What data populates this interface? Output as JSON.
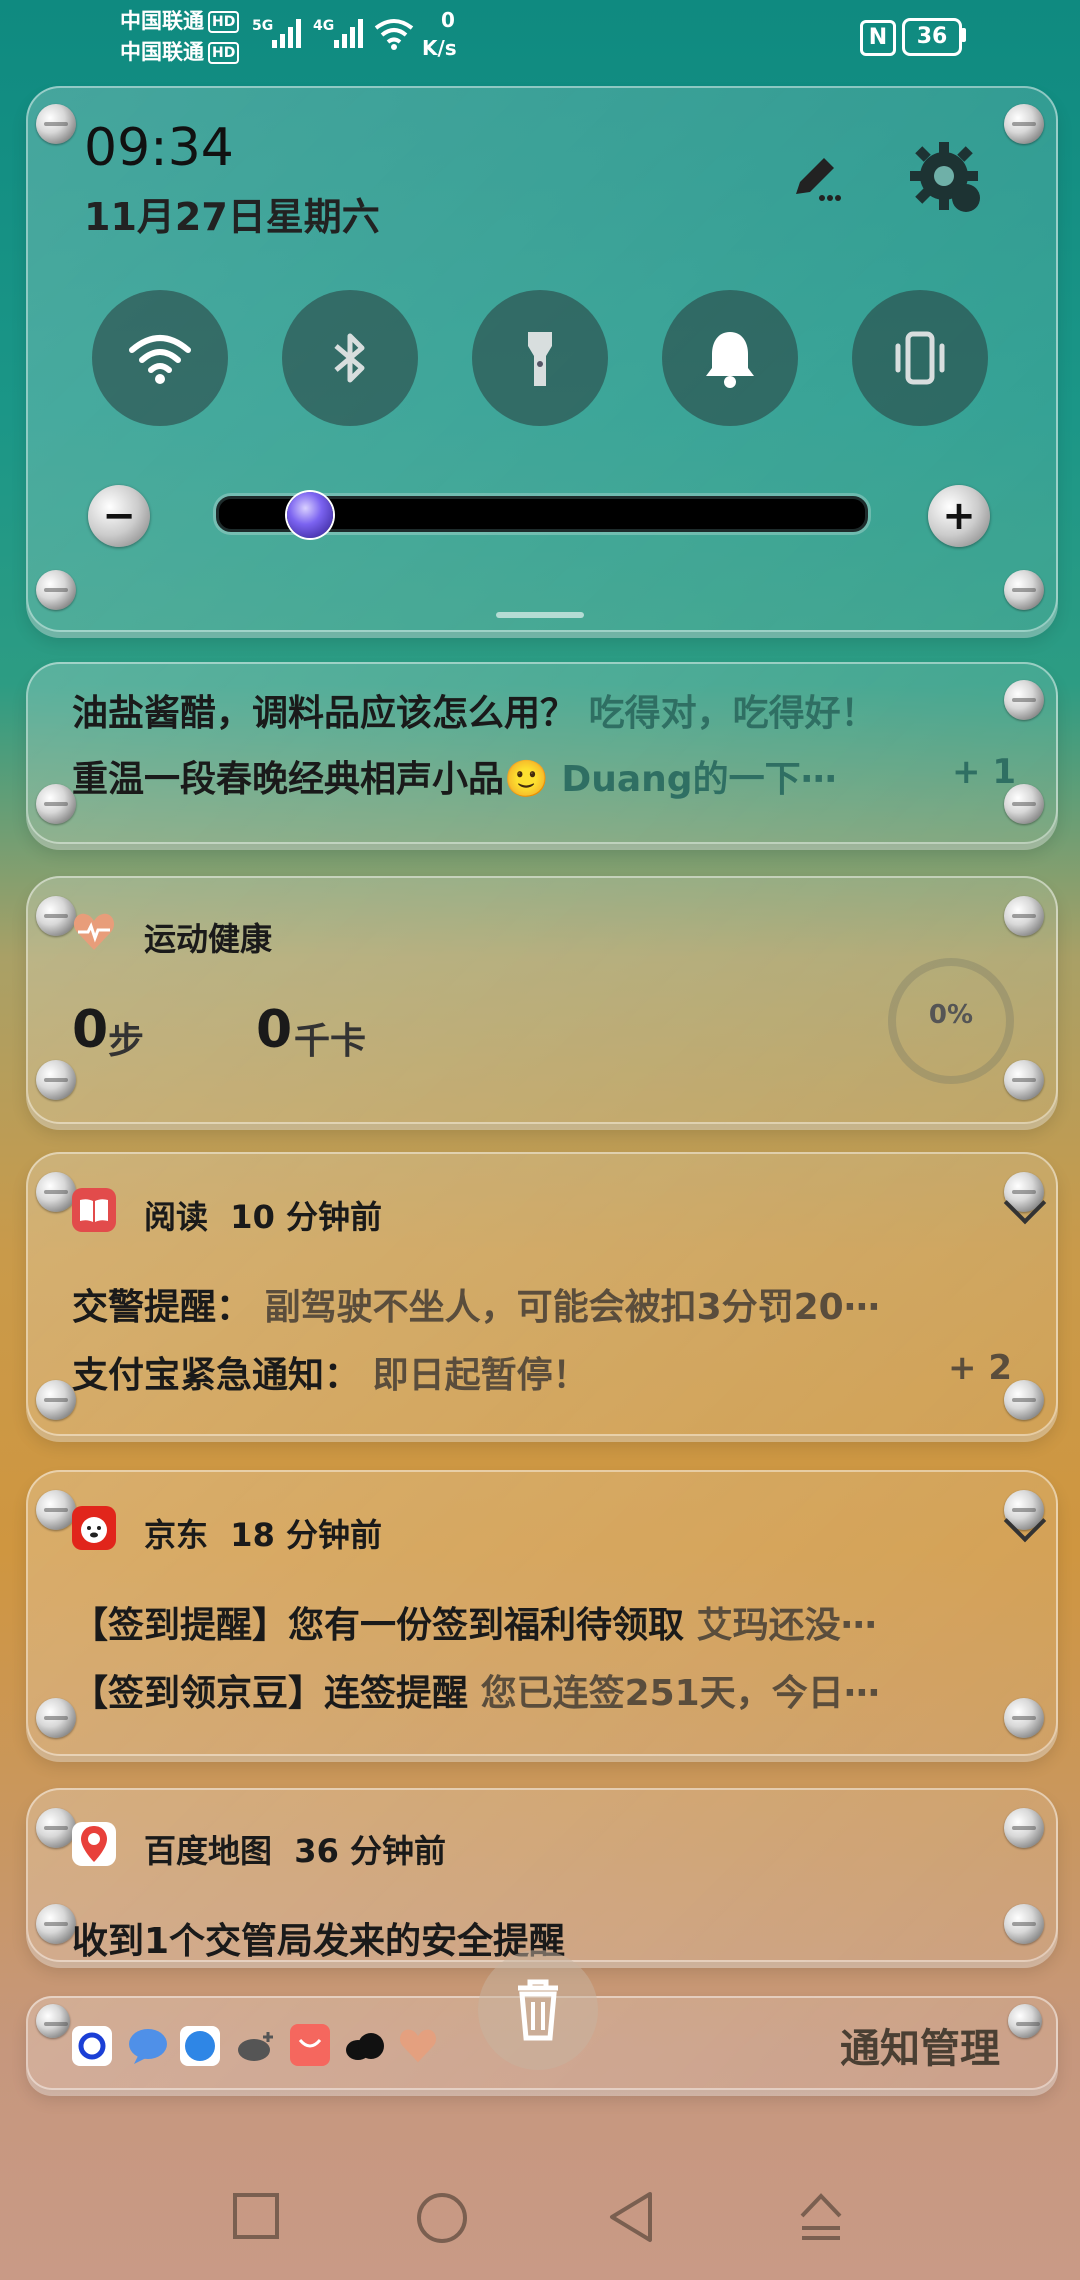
{
  "status": {
    "carrier1": "中国联通",
    "carrier2": "中国联通",
    "hd": "HD",
    "net1": "5G",
    "net2": "4G",
    "speed_value": "0",
    "speed_unit": "K/s",
    "battery": "36",
    "nfc": "N"
  },
  "control": {
    "time": "09:34",
    "date": "11月27日星期六",
    "brightness_percent": 12,
    "toggles": [
      "wifi",
      "bluetooth",
      "flashlight",
      "bell",
      "vibrate"
    ]
  },
  "news": {
    "line1_title": "油盐酱醋，调料品应该怎么用？",
    "line1_extra": "吃得对，吃得好！",
    "line2_title": "重温一段春晚经典相声小品🙂",
    "line2_extra": "Duang的一下⋯",
    "count": "+ 1"
  },
  "health": {
    "title": "运动健康",
    "steps_value": "0",
    "steps_unit": "步",
    "kcal_value": "0",
    "kcal_unit": "千卡",
    "progress": "0%"
  },
  "read": {
    "app": "阅读",
    "time": "10 分钟前",
    "l1_title": "交警提醒：",
    "l1_text": "副驾驶不坐人，可能会被扣3分罚20⋯",
    "l2_title": "支付宝紧急通知：",
    "l2_text": "即日起暂停！",
    "count": "+ 2"
  },
  "jd": {
    "app": "京东",
    "time": "18 分钟前",
    "l1_title": "【签到提醒】您有一份签到福利待领取",
    "l1_text": "艾玛还没⋯",
    "l2_title": "【签到领京豆】连签提醒",
    "l2_text": "您已连签251天，今日⋯"
  },
  "map": {
    "app": "百度地图",
    "time": "36 分钟前",
    "text": "收到1个交管局发来的安全提醒"
  },
  "bottom": {
    "manage": "通知管理",
    "app_icons": [
      "qq-browser",
      "message",
      "safari-like",
      "cloud-plus",
      "shopping-bag",
      "cloud-dark",
      "heart"
    ]
  },
  "colors": {
    "accent_purple": "#7b63f0",
    "jd_red": "#e1251b",
    "read_red": "#e24b4b"
  }
}
